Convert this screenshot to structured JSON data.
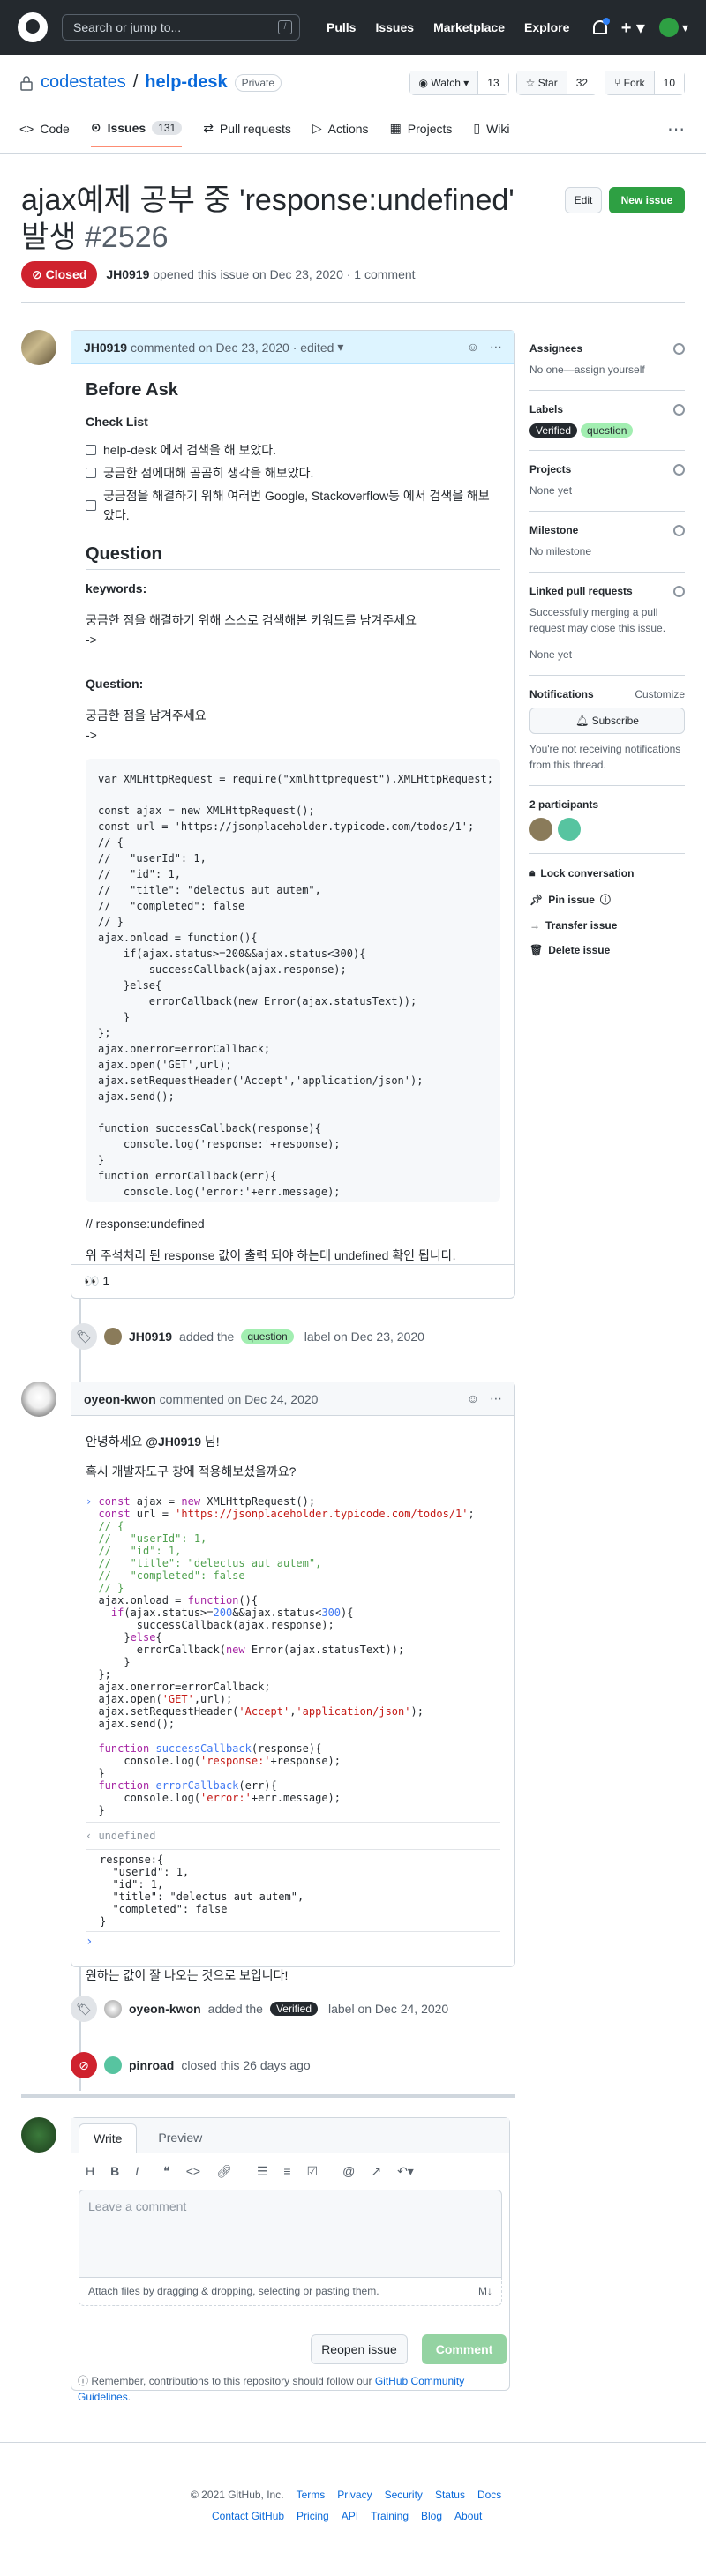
{
  "header": {
    "search_placeholder": "Search or jump to...",
    "slash_key": "/",
    "nav": [
      "Pulls",
      "Issues",
      "Marketplace",
      "Explore"
    ]
  },
  "repo": {
    "owner": "codestates",
    "separator": "/",
    "name": "help-desk",
    "visibility": "Private",
    "watch_label": "Watch",
    "watch_count": "13",
    "star_label": "Star",
    "star_count": "32",
    "fork_label": "Fork",
    "fork_count": "10",
    "tabs": [
      {
        "label": "Code"
      },
      {
        "label": "Issues",
        "count": "131"
      },
      {
        "label": "Pull requests"
      },
      {
        "label": "Actions"
      },
      {
        "label": "Projects"
      },
      {
        "label": "Wiki"
      }
    ]
  },
  "issue": {
    "title": "ajax예제 공부 중 'response:undefined' 발생",
    "number": "#2526",
    "edit_label": "Edit",
    "new_issue_label": "New issue",
    "state": "Closed",
    "author": "JH0919",
    "meta_rest": "opened this issue on Dec 23, 2020 · 1 comment"
  },
  "first_comment": {
    "author": "JH0919",
    "meta": "commented on Dec 23, 2020 · edited",
    "h_before": "Before Ask",
    "h_check": "Check List",
    "checks": [
      "help-desk 에서 검색을 해 보았다.",
      "궁금한 점에대해 곰곰히 생각을 해보았다.",
      "궁금점을 해결하기 위해 여러번 Google, Stackoverflow등 에서 검색을 해보았다."
    ],
    "h_question": "Question",
    "keywords_label": "keywords:",
    "keywords_text": "궁금한 점을 해결하기 위해 스스로 검색해본 키워드를 남겨주세요",
    "arrow1": "->",
    "question_label": "Question:",
    "question_text": "궁금한 점을 남겨주세요",
    "arrow2": "->",
    "code": "var XMLHttpRequest = require(\"xmlhttprequest\").XMLHttpRequest;\n\nconst ajax = new XMLHttpRequest();\nconst url = 'https://jsonplaceholder.typicode.com/todos/1';\n// {\n//   \"userId\": 1,\n//   \"id\": 1,\n//   \"title\": \"delectus aut autem\",\n//   \"completed\": false\n// }\najax.onload = function(){\n    if(ajax.status>=200&&ajax.status<300){\n        successCallback(ajax.response);\n    }else{\n        errorCallback(new Error(ajax.statusText));\n    }\n};\najax.onerror=errorCallback;\najax.open('GET',url);\najax.setRequestHeader('Accept','application/json');\najax.send();\n\nfunction successCallback(response){\n    console.log('response:'+response);\n}\nfunction errorCallback(err){\n    console.log('error:'+err.message);\n}",
    "result": "// response:undefined",
    "note": "위 주석처리 된 response 값이 출력 되야 하는데 undefined 확인 됩니다.",
    "reaction_emoji": "👀",
    "reaction_count": "1"
  },
  "label_event": {
    "author": "JH0919",
    "text_a": "added the",
    "label": "question",
    "text_b": "label on Dec 23, 2020"
  },
  "second_comment": {
    "author": "oyeon-kwon",
    "meta": "commented on Dec 24, 2020",
    "greeting": "안녕하세요",
    "mention": "@JH0919",
    "greeting_tail": "님!",
    "line2": "혹시 개발자도구 창에 적용해보셨을까요?",
    "console_undefined": "undefined",
    "console_output": "response:{\n  \"userId\": 1,\n  \"id\": 1,\n  \"title\": \"delectus aut autem\",\n  \"completed\": false\n}",
    "closing": "원하는 값이 잘 나오는 것으로 보입니다!"
  },
  "verified_event": {
    "author": "oyeon-kwon",
    "text_a": "added the",
    "label": "Verified",
    "text_b": "label on Dec 24, 2020"
  },
  "closed_event": {
    "author": "pinroad",
    "text": "closed this 26 days ago"
  },
  "write": {
    "tab_write": "Write",
    "tab_preview": "Preview",
    "placeholder": "Leave a comment",
    "attach_text": "Attach files by dragging & dropping, selecting or pasting them.",
    "reopen_label": "Reopen issue",
    "comment_label": "Comment",
    "notice_a": "Remember, contributions to this repository should follow our",
    "notice_link": "GitHub Community Guidelines",
    "notice_end": "."
  },
  "sidebar": {
    "assignees_label": "Assignees",
    "assignees_text": "No one—assign yourself",
    "labels_label": "Labels",
    "label_verified": "Verified",
    "label_question": "question",
    "projects_label": "Projects",
    "projects_text": "None yet",
    "milestone_label": "Milestone",
    "milestone_text": "No milestone",
    "linked_label": "Linked pull requests",
    "linked_text": "Successfully merging a pull request may close this issue.",
    "linked_none": "None yet",
    "notifications_label": "Notifications",
    "customize": "Customize",
    "subscribe": "Subscribe",
    "notif_text": "You're not receiving notifications from this thread.",
    "participants_label": "2 participants",
    "actions": [
      "Lock conversation",
      "Pin issue",
      "Transfer issue",
      "Delete issue"
    ]
  },
  "footer": {
    "copyright": "© 2021 GitHub, Inc.",
    "row1": [
      "Terms",
      "Privacy",
      "Security",
      "Status",
      "Docs"
    ],
    "row2": [
      "Contact GitHub",
      "Pricing",
      "API",
      "Training",
      "Blog",
      "About"
    ]
  },
  "colors": {
    "closed": "#cf222e",
    "new_issue": "#2ea043",
    "label_question": "#a2eeb1",
    "label_verified": "#24292e"
  }
}
